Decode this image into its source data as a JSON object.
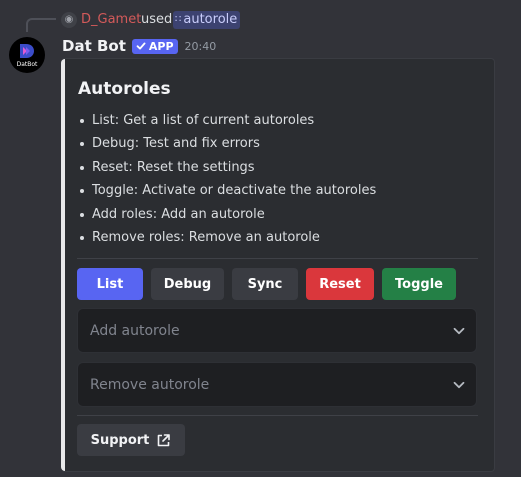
{
  "reply": {
    "user": "D_Gamet",
    "verb": "used",
    "command": "autorole"
  },
  "message": {
    "bot_name": "Dat Bot",
    "badge": "APP",
    "time": "20:40",
    "avatar_text": "DatBot"
  },
  "embed": {
    "title": "Autoroles",
    "items": [
      "List: Get a list of current autoroles",
      "Debug: Test and fix errors",
      "Reset: Reset the settings",
      "Toggle: Activate or deactivate the autoroles",
      "Add roles: Add an autorole",
      "Remove roles: Remove an autorole"
    ],
    "accent_color": "#e9e9ea"
  },
  "buttons": [
    {
      "label": "List",
      "color": "#5865f2"
    },
    {
      "label": "Debug",
      "color": "#3a3c42"
    },
    {
      "label": "Sync",
      "color": "#3a3c42"
    },
    {
      "label": "Reset",
      "color": "#da373c"
    },
    {
      "label": "Toggle",
      "color": "#248046"
    }
  ],
  "selects": [
    {
      "placeholder": "Add autorole"
    },
    {
      "placeholder": "Remove autorole"
    }
  ],
  "support": {
    "label": "Support",
    "icon": "external-link-icon"
  }
}
